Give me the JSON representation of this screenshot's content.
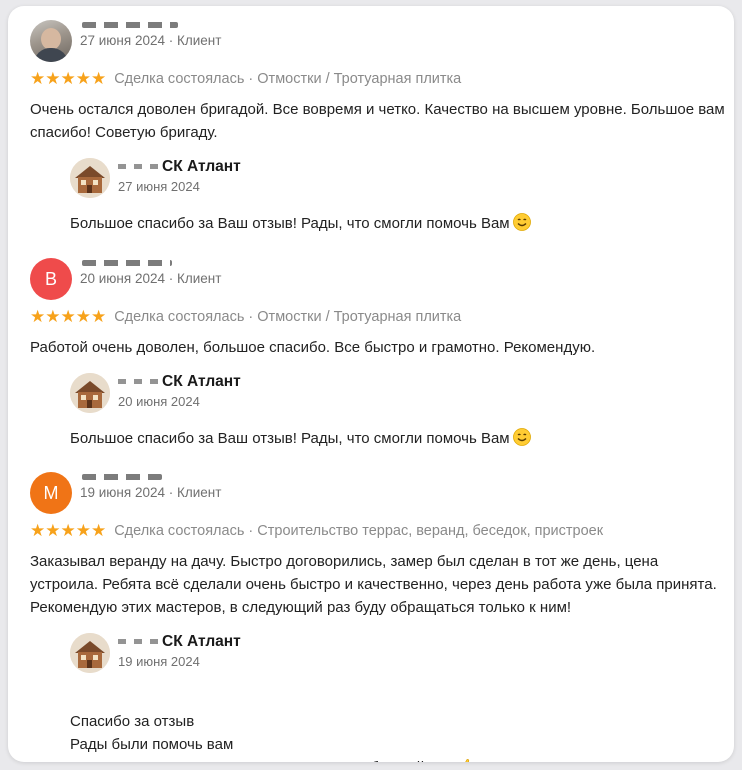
{
  "reviews": [
    {
      "avatar_initial": "",
      "avatar_type": "photo",
      "avatar_color": "#9d958c",
      "meta": "27 июня 2024 · Клиент",
      "stars": "★★★★★",
      "rating": 5,
      "tags": "Сделка состоялась · Отмостки / Тротуарная плитка",
      "text": "Очень остался доволен бригадой. Все вовремя и четко. Качество на высшем уровне. Большое вам спасибо! Советую бригаду.",
      "reply": {
        "company": "СК Атлант",
        "date": "27 июня 2024",
        "text": "Большое спасибо за Ваш отзыв! Рады, что смогли помочь Вам",
        "emoji": "smile"
      }
    },
    {
      "avatar_initial": "В",
      "avatar_type": "letter",
      "avatar_color": "#ef4b4b",
      "meta": "20 июня 2024 · Клиент",
      "stars": "★★★★★",
      "rating": 5,
      "tags": "Сделка состоялась · Отмостки / Тротуарная плитка",
      "text": "Работой очень доволен, большое спасибо. Все быстро и грамотно. Рекомендую.",
      "reply": {
        "company": "СК Атлант",
        "date": "20 июня 2024",
        "text": "Большое спасибо за Ваш отзыв! Рады, что смогли помочь Вам",
        "emoji": "smile"
      }
    },
    {
      "avatar_initial": "М",
      "avatar_type": "letter",
      "avatar_color": "#f07416",
      "meta": "19 июня 2024 · Клиент",
      "stars": "★★★★★",
      "rating": 5,
      "tags": "Сделка состоялась · Строительство террас, веранд, беседок, пристроек",
      "text": "Заказывал веранду на дачу. Быстро договорились, замер был сделан в тот же день, цена устроила. Ребята всё сделали очень быстро и качественно, через день работа уже была принята. Рекомендую этих мастеров, в следующий раз буду обращаться только к ним!",
      "reply": {
        "company": "СК Атлант",
        "date": "19 июня 2024",
        "text": "Спасибо за отзыв\nРады были помочь вам\nБудут планы по строительству и ремонту обращайтесь",
        "emoji": "thumbs-up"
      }
    }
  ],
  "colors": {
    "star": "#f7a21b",
    "meta_text": "#707070",
    "tag_text": "#8a8a8a"
  }
}
